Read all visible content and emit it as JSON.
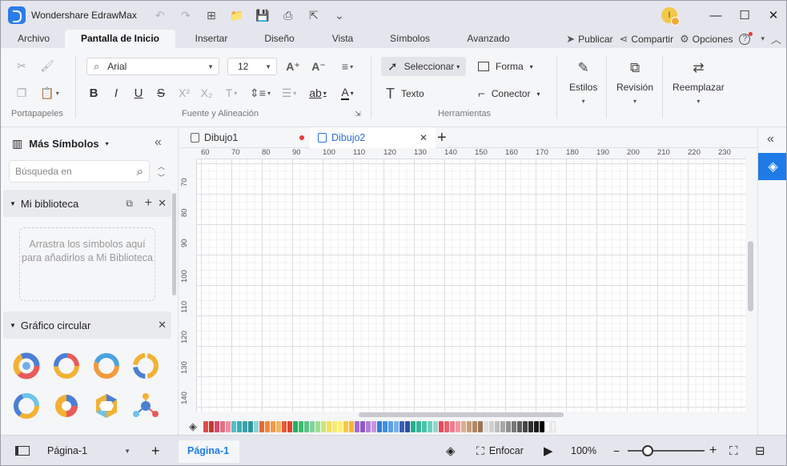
{
  "app": {
    "title": "Wondershare EdrawMax",
    "user_initial": "I"
  },
  "menu": {
    "tabs": [
      {
        "label": "Archivo"
      },
      {
        "label": "Pantalla de Inicio",
        "active": true
      },
      {
        "label": "Insertar"
      },
      {
        "label": "Diseño"
      },
      {
        "label": "Vista"
      },
      {
        "label": "Símbolos"
      },
      {
        "label": "Avanzado"
      }
    ],
    "publish": "Publicar",
    "share": "Compartir",
    "options": "Opciones",
    "help": "?"
  },
  "ribbon": {
    "font_name": "Arial",
    "font_size": "12",
    "groups": {
      "clipboard": "Portapapeles",
      "font": "Fuente y Alineación",
      "tools": "Herramientas"
    },
    "select": "Seleccionar",
    "shape": "Forma",
    "text": "Texto",
    "connector": "Conector",
    "styles": "Estilos",
    "review": "Revisión",
    "replace": "Reemplazar"
  },
  "left_panel": {
    "title": "Más Símbolos",
    "search_placeholder": "Búsqueda en",
    "library": "Mi biblioteca",
    "library_hint": "Arrastra los símbolos aquí para añadirlos a Mi Biblioteca",
    "category": "Gráfico circular"
  },
  "documents": {
    "tabs": [
      {
        "label": "Dibujo1",
        "unsaved": true
      },
      {
        "label": "Dibujo2",
        "active": true
      }
    ]
  },
  "rulers": {
    "top": [
      "60",
      "70",
      "80",
      "90",
      "100",
      "110",
      "120",
      "130",
      "140",
      "150",
      "160",
      "170",
      "180",
      "190",
      "200",
      "210",
      "220",
      "230"
    ],
    "left": [
      "70",
      "80",
      "90",
      "100",
      "110",
      "120",
      "130",
      "140"
    ]
  },
  "status": {
    "page_select": "Página-1",
    "active_page": "Página-1",
    "focus": "Enfocar",
    "zoom": "100%"
  },
  "colors": {
    "accent": "#1e7be7",
    "palette": [
      "#e24a4a",
      "#c0392b",
      "#d64a6b",
      "#e56f82",
      "#f08fa0",
      "#4fc1c7",
      "#3aaeb5",
      "#38a1a8",
      "#2f94a0",
      "#8fd3d6",
      "#e86a2e",
      "#f0883e",
      "#f29a4d",
      "#f5b264",
      "#e8583b",
      "#d9462e",
      "#27ae60",
      "#3cbc6e",
      "#59c782",
      "#7fd49c",
      "#a0de8f",
      "#c9e67a",
      "#f1e05a",
      "#f7ea7a",
      "#fff27a",
      "#f5c842",
      "#f3b733",
      "#a26bd1",
      "#8e5ac6",
      "#b27fdb",
      "#c596e3",
      "#2f7fd6",
      "#3f8fe0",
      "#5aa0e6",
      "#78b2ea",
      "#3a5fb8",
      "#2d4fa3",
      "#27ae8a",
      "#34b79a",
      "#48c3aa",
      "#6cd0bd",
      "#8cdacb",
      "#e84a5f",
      "#ec6272",
      "#f07d8a",
      "#f497a1",
      "#d9b08c",
      "#c99c76",
      "#b08766",
      "#9b7456",
      "#e0e0e0",
      "#cfcfcf",
      "#bdbdbd",
      "#a8a8a8",
      "#909090",
      "#777777",
      "#5e5e5e",
      "#454545",
      "#2e2e2e",
      "#1a1a1a",
      "#000000",
      "#ffffff",
      "#f2f2f2"
    ]
  }
}
